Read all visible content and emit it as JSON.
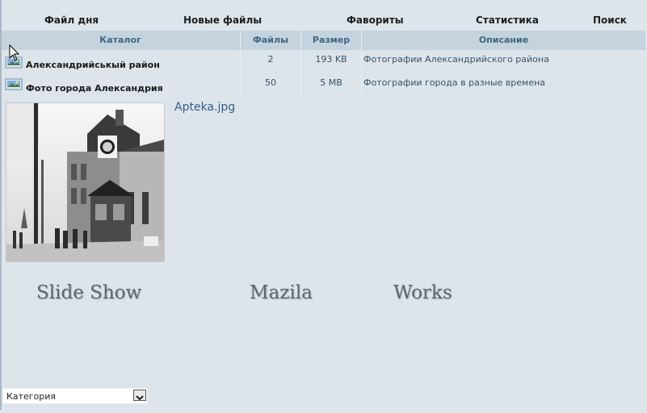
{
  "nav": {
    "items": [
      {
        "label": "Файл дня",
        "key": "file_of_day"
      },
      {
        "label": "Новые файлы",
        "key": "new_files"
      },
      {
        "label": "Фавориты",
        "key": "favorites"
      },
      {
        "label": "Статистика",
        "key": "statistics"
      },
      {
        "label": "Поиск",
        "key": "search"
      }
    ]
  },
  "table": {
    "headers": [
      "Каталог",
      "Файлы",
      "Размер",
      "Описание"
    ],
    "rows": [
      {
        "name": "Александрийськый район",
        "files": "2",
        "size": "193 KB",
        "description": "Фотографии Александрийского района"
      },
      {
        "name": "Фото города Александрия",
        "files": "50",
        "size": "5 MB",
        "description": "Фотографии города в разные времена"
      }
    ]
  },
  "featured": {
    "caption": "Apteka.jpg"
  },
  "links": [
    "Slide Show",
    "Mazila",
    "Works"
  ],
  "category_select": {
    "value": "Категория"
  },
  "colors": {
    "background": "#dde5eb",
    "header": "#c4d3de",
    "header_text": "#3c6787"
  }
}
